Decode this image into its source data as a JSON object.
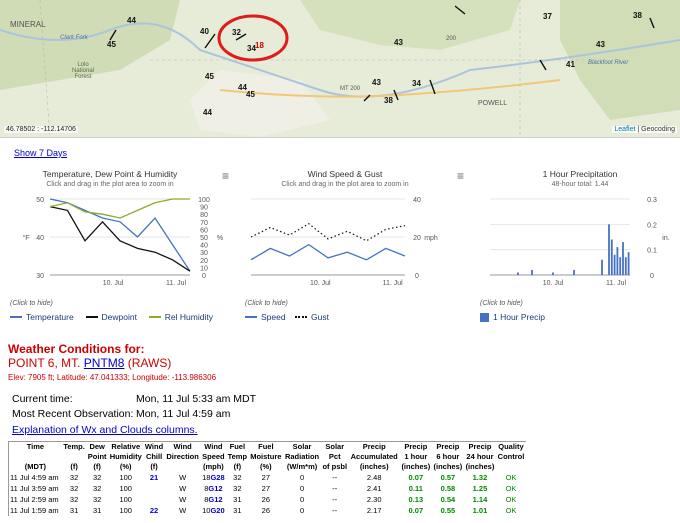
{
  "map": {
    "coords": "46.78502 : -112.14706",
    "attribution_leaflet": "Leaflet",
    "attribution_rest": " | Geocoding",
    "labels": [
      {
        "text": "MINERAL",
        "kind": "place"
      },
      {
        "text": "Lolo\nNational\nForest",
        "kind": "place"
      },
      {
        "text": "MT 200",
        "kind": "road"
      },
      {
        "text": "POWELL",
        "kind": "place"
      },
      {
        "text": "200",
        "kind": "road"
      },
      {
        "text": "Clark Fork",
        "kind": "river"
      },
      {
        "text": "Blackfoot River",
        "kind": "river"
      }
    ],
    "stations": [
      "44",
      "45",
      "40",
      "32",
      "34",
      "43",
      "45",
      "44",
      "45",
      "44",
      "43",
      "38",
      "34",
      "43",
      "41",
      "37",
      "38"
    ],
    "highlight_value": "18"
  },
  "show7": "Show 7 Days",
  "charts": [
    {
      "title": "Temperature, Dew Point & Humidity",
      "subtitle": "Click and drag in the plot area to zoom in",
      "left_ticks": [
        "50",
        "40",
        "30"
      ],
      "right_ticks": [
        "100",
        "90",
        "80",
        "70",
        "60",
        "50",
        "40",
        "30",
        "20",
        "10",
        "0"
      ],
      "left_unit": "°F",
      "right_unit": "%",
      "x_ticks": [
        "10. Jul",
        "11. Jul"
      ],
      "click_hide": "(Click to hide)",
      "legend": [
        "Temperature",
        "Dewpoint",
        "Rel Humidity"
      ],
      "colors": {
        "Temperature": "#4572c4",
        "Dewpoint": "#111111",
        "Rel Humidity": "#8bab2b"
      }
    },
    {
      "title": "Wind Speed & Gust",
      "subtitle": "Click and drag in the plot area to zoom in",
      "right_ticks": [
        "40",
        "20",
        "0"
      ],
      "right_unit": "mph",
      "x_ticks": [
        "10. Jul",
        "11. Jul"
      ],
      "click_hide": "(Click to hide)",
      "legend": [
        "Speed",
        "Gust"
      ]
    },
    {
      "title": "1 Hour Precipitation",
      "subtitle": "48-hour total: 1.44",
      "right_ticks": [
        "0.3",
        "0.2",
        "0.1",
        "0"
      ],
      "right_unit": "in.",
      "x_ticks": [
        "10. Jul",
        "11. Jul"
      ],
      "click_hide": "(Click to hide)",
      "legend": [
        "1 Hour Precip"
      ]
    }
  ],
  "chart_data": [
    {
      "type": "line",
      "title": "Temperature, Dew Point & Humidity",
      "x": [
        "9 Jul 06:00",
        "9 Jul 12:00",
        "9 Jul 18:00",
        "10 Jul 00:00",
        "10 Jul 06:00",
        "10 Jul 12:00",
        "10 Jul 18:00",
        "11 Jul 00:00",
        "11 Jul 06:00"
      ],
      "series": [
        {
          "name": "Temperature",
          "axis": "left",
          "values": [
            50,
            49,
            47,
            45,
            44,
            40,
            45,
            38,
            31
          ]
        },
        {
          "name": "Dewpoint",
          "axis": "left",
          "values": [
            48,
            47,
            39,
            44,
            39,
            37,
            36,
            34,
            31
          ]
        },
        {
          "name": "Rel Humidity",
          "axis": "right",
          "values": [
            90,
            95,
            83,
            80,
            75,
            85,
            95,
            100,
            100
          ]
        }
      ],
      "ylim_left": [
        30,
        50
      ],
      "ylim_right": [
        0,
        100
      ]
    },
    {
      "type": "line",
      "title": "Wind Speed & Gust",
      "x": [
        "9 Jul 06:00",
        "9 Jul 12:00",
        "9 Jul 18:00",
        "10 Jul 00:00",
        "10 Jul 06:00",
        "10 Jul 12:00",
        "10 Jul 18:00",
        "11 Jul 00:00",
        "11 Jul 06:00"
      ],
      "series": [
        {
          "name": "Speed",
          "values": [
            8,
            14,
            10,
            16,
            9,
            12,
            8,
            14,
            10
          ]
        },
        {
          "name": "Gust",
          "values": [
            20,
            25,
            21,
            27,
            19,
            23,
            18,
            24,
            26
          ]
        }
      ],
      "ylim": [
        0,
        40
      ]
    },
    {
      "type": "bar",
      "title": "1 Hour Precipitation",
      "x": [
        "10 Jul 00:00",
        "10 Jul 06:00",
        "10 Jul 12:00",
        "10 Jul 18:00",
        "10 Jul 21:00",
        "10 Jul 22:00",
        "10 Jul 23:00",
        "11 Jul 00:00",
        "11 Jul 01:00",
        "11 Jul 02:00",
        "11 Jul 03:00",
        "11 Jul 04:00",
        "11 Jul 05:00"
      ],
      "series": [
        {
          "name": "1 Hour Precip",
          "values": [
            0.01,
            0.02,
            0.01,
            0.02,
            0.06,
            0.2,
            0.14,
            0.08,
            0.11,
            0.07,
            0.13,
            0.07,
            0.09
          ]
        }
      ],
      "ylim": [
        0,
        0.3
      ]
    }
  ],
  "conditions": {
    "title": "Weather Conditions for:",
    "station_prefix": "POINT 6, MT. ",
    "station_link": "PNTM8",
    "station_suffix": " (RAWS)",
    "elev": "Elev: 7905 ft; Latitude: 47.041333; Longitude: -113.986306",
    "current_label": "Current time:",
    "current_value": "Mon, 11 Jul 5:33 am MDT",
    "recent_label": "Most Recent Observation:",
    "recent_value": "Mon, 11 Jul 4:59 am",
    "explain": "Explanation of Wx and Clouds columns."
  },
  "table": {
    "h1": [
      "Time",
      "Temp.",
      "Dew",
      "Relative",
      "Wind",
      "Wind",
      "Wind",
      "Fuel",
      "Fuel",
      "Solar",
      "Solar",
      "Precip",
      "Precip",
      "Precip",
      "Precip",
      "Quality"
    ],
    "h2": [
      "",
      "",
      "Point",
      "Humidity",
      "Chill",
      "Direction",
      "Speed",
      "Temp",
      "Moisture",
      "Radiation",
      "Pct",
      "Accumulated",
      "1 hour",
      "6 hour",
      "24 hour",
      "Control"
    ],
    "h3": [
      "(MDT)",
      "(f)",
      "(f)",
      "(%)",
      "(f)",
      "",
      "(mph)",
      "(f)",
      "(%)",
      "(W/m*m)",
      "of psbl",
      "(inches)",
      "(inches)",
      "(inches)",
      "(inches)",
      ""
    ],
    "rows": [
      {
        "time": "11 Jul 4:59 am",
        "temp": "32",
        "dew": "32",
        "rh": "100",
        "chill": "21",
        "dir": "W",
        "spd": "18",
        "gust": "28",
        "ftemp": "32",
        "fmoist": "27",
        "srad": "0",
        "spct": "--",
        "acc": "2.48",
        "p1": "0.07",
        "p6": "0.57",
        "p24": "1.32",
        "qc": "OK"
      },
      {
        "time": "11 Jul 3:59 am",
        "temp": "32",
        "dew": "32",
        "rh": "100",
        "chill": "",
        "dir": "W",
        "spd": "8",
        "gust": "12",
        "ftemp": "32",
        "fmoist": "27",
        "srad": "0",
        "spct": "--",
        "acc": "2.41",
        "p1": "0.11",
        "p6": "0.58",
        "p24": "1.25",
        "qc": "OK"
      },
      {
        "time": "11 Jul 2:59 am",
        "temp": "32",
        "dew": "32",
        "rh": "100",
        "chill": "",
        "dir": "W",
        "spd": "8",
        "gust": "12",
        "ftemp": "31",
        "fmoist": "26",
        "srad": "0",
        "spct": "--",
        "acc": "2.30",
        "p1": "0.13",
        "p6": "0.54",
        "p24": "1.14",
        "qc": "OK"
      },
      {
        "time": "11 Jul 1:59 am",
        "temp": "31",
        "dew": "31",
        "rh": "100",
        "chill": "22",
        "dir": "W",
        "spd": "10",
        "gust": "20",
        "ftemp": "31",
        "fmoist": "26",
        "srad": "0",
        "spct": "--",
        "acc": "2.17",
        "p1": "0.07",
        "p6": "0.55",
        "p24": "1.01",
        "qc": "OK"
      }
    ]
  }
}
